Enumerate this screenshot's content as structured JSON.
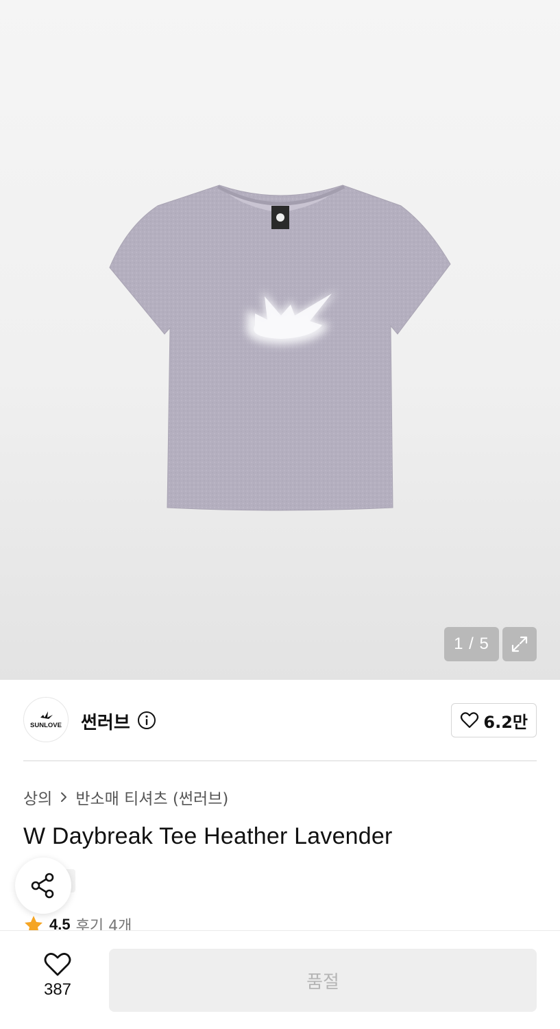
{
  "gallery": {
    "counter": "1 / 5",
    "image_alt": "W Daybreak Tee Heather Lavender",
    "shirt_color": "#b4afbf"
  },
  "brand": {
    "logo_text": "SUNLOVE",
    "name": "썬러브",
    "likes": "6.2만"
  },
  "breadcrumb": {
    "category": "상의",
    "subcategory": "반소매 티셔츠 (썬러브)"
  },
  "product": {
    "title": "W Daybreak Tee Heather Lavender",
    "tag_text": "쿠",
    "rating": "4.5",
    "reviews": "후기 4개"
  },
  "bottom_bar": {
    "wishlist_count": "387",
    "buy_label": "품절"
  },
  "icons": {
    "expand": "expand-icon",
    "info": "info-icon",
    "heart": "heart-icon",
    "share": "share-icon",
    "star": "star-icon",
    "chevron": "chevron-right-icon"
  },
  "colors": {
    "star": "#f5a524",
    "soldout_bg": "#eeeeee",
    "soldout_text": "#b5b5b5"
  }
}
